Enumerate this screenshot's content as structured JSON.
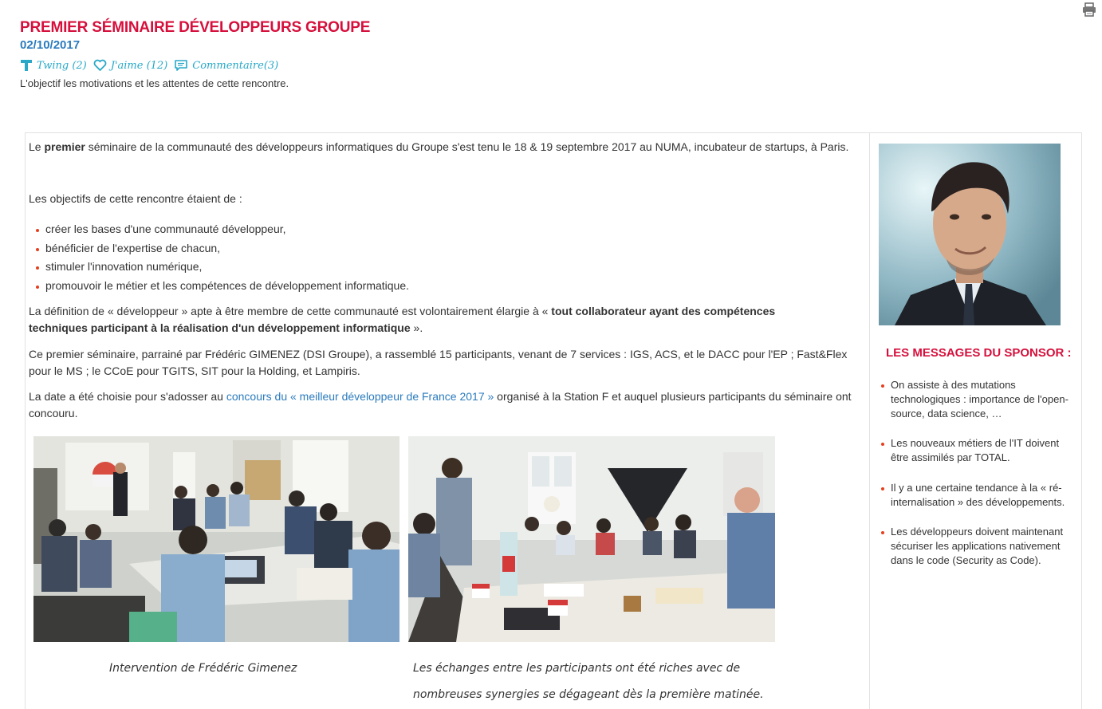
{
  "article": {
    "title": "PREMIER SÉMINAIRE DÉVELOPPEURS GROUPE",
    "date": "02/10/2017",
    "summary": "L'objectif les motivations et les attentes de cette rencontre."
  },
  "social": {
    "twing": "Twing (2)",
    "like": "J'aime (12)",
    "comments": "Commentaire(3)"
  },
  "body": {
    "intro_prefix": "Le ",
    "intro_bold": "premier",
    "intro_rest": " séminaire de la communauté des développeurs informatiques du Groupe s'est tenu le 18 & 19 septembre 2017 au NUMA, incubateur de startups, à Paris.",
    "objectives_intro": "Les objectifs de cette rencontre étaient de :",
    "objectives": [
      "créer les bases d'une communauté développeur,",
      "bénéficier de l'expertise de chacun,",
      "stimuler l'innovation numérique,",
      "promouvoir le métier et les compétences de développement informatique."
    ],
    "definition_prefix": "La définition de « développeur » apte à être membre de cette communauté est volontairement élargie à « ",
    "definition_bold": "tout collaborateur ayant des compétences techniques participant à la réalisation d'un développement informatique",
    "definition_suffix": " ».",
    "seminar": "Ce premier séminaire, parrainé par Frédéric GIMENEZ (DSI Groupe), a rassemblé 15 participants, venant de 7 services : IGS, ACS, et le DACC pour l'EP ; Fast&Flex pour le MS ; le CCoE pour TGITS, SIT pour la Holding, et Lampiris.",
    "date_prefix": "La date a été choisie pour s'adosser au ",
    "date_link": "concours du « meilleur développeur de France 2017 »",
    "date_suffix": " organisé à la Station F et auquel plusieurs participants du séminaire ont concouru.",
    "caption1": "Intervention de Frédéric Gimenez",
    "caption2": "Les échanges entre les participants ont été riches avec de nombreuses synergies se dégageant dès la première matinée."
  },
  "sidebar": {
    "title": "LES MESSAGES DU SPONSOR :",
    "messages": [
      "On assiste à des mutations technologiques : importance de l'open-source, data science, …",
      "Les nouveaux métiers de l'IT doivent être assimilés par TOTAL.",
      "Il y a une certaine tendance à la « ré-internalisation » des développements.",
      "Les développeurs doivent maintenant sécuriser les applications nativement dans le code (Security as Code)."
    ]
  },
  "colors": {
    "title": "#d6103c",
    "date": "#2b7bbd",
    "social": "#29a8c8",
    "bullet": "#e4401e",
    "link": "#2b7bbd"
  },
  "icons": [
    "print-icon",
    "twing-icon",
    "heart-icon",
    "comment-icon"
  ]
}
